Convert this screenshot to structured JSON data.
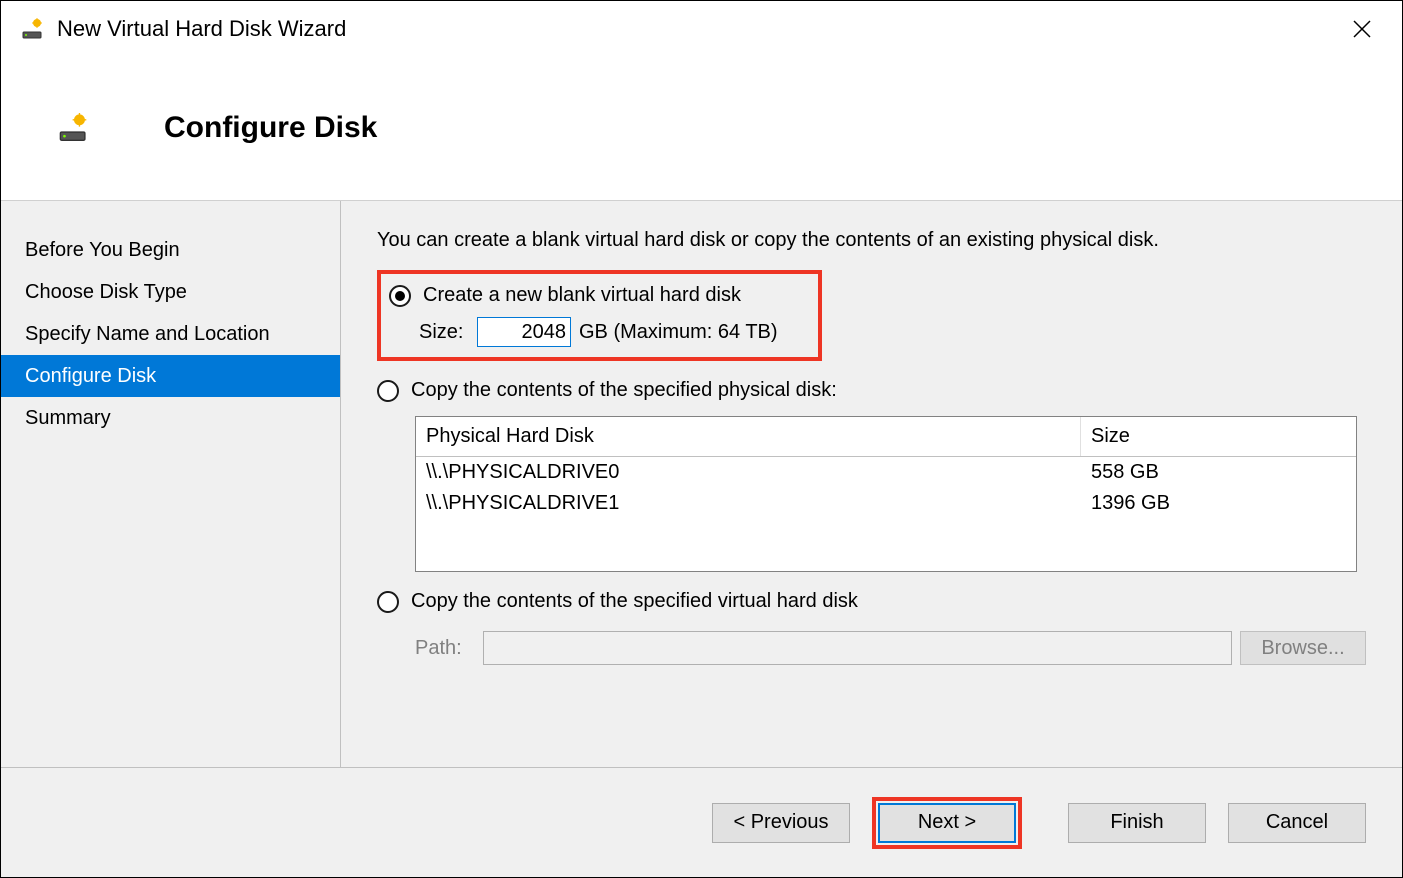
{
  "title": "New Virtual Hard Disk Wizard",
  "step_title": "Configure Disk",
  "sidebar": {
    "items": [
      {
        "label": "Before You Begin"
      },
      {
        "label": "Choose Disk Type"
      },
      {
        "label": "Specify Name and Location"
      },
      {
        "label": "Configure Disk"
      },
      {
        "label": "Summary"
      }
    ],
    "active_index": 3
  },
  "intro": "You can create a blank virtual hard disk or copy the contents of an existing physical disk.",
  "option1": {
    "label": "Create a new blank virtual hard disk",
    "size_label": "Size:",
    "size_value": "2048",
    "size_unit": "GB (Maximum: 64 TB)"
  },
  "option2": {
    "label": "Copy the contents of the specified physical disk:",
    "header_disk": "Physical Hard Disk",
    "header_size": "Size",
    "rows": [
      {
        "disk": "\\\\.\\PHYSICALDRIVE0",
        "size": "558 GB"
      },
      {
        "disk": "\\\\.\\PHYSICALDRIVE1",
        "size": "1396 GB"
      }
    ]
  },
  "option3": {
    "label": "Copy the contents of the specified virtual hard disk",
    "path_label": "Path:",
    "path_value": "",
    "browse_label": "Browse..."
  },
  "footer": {
    "previous": "< Previous",
    "next": "Next >",
    "finish": "Finish",
    "cancel": "Cancel"
  }
}
